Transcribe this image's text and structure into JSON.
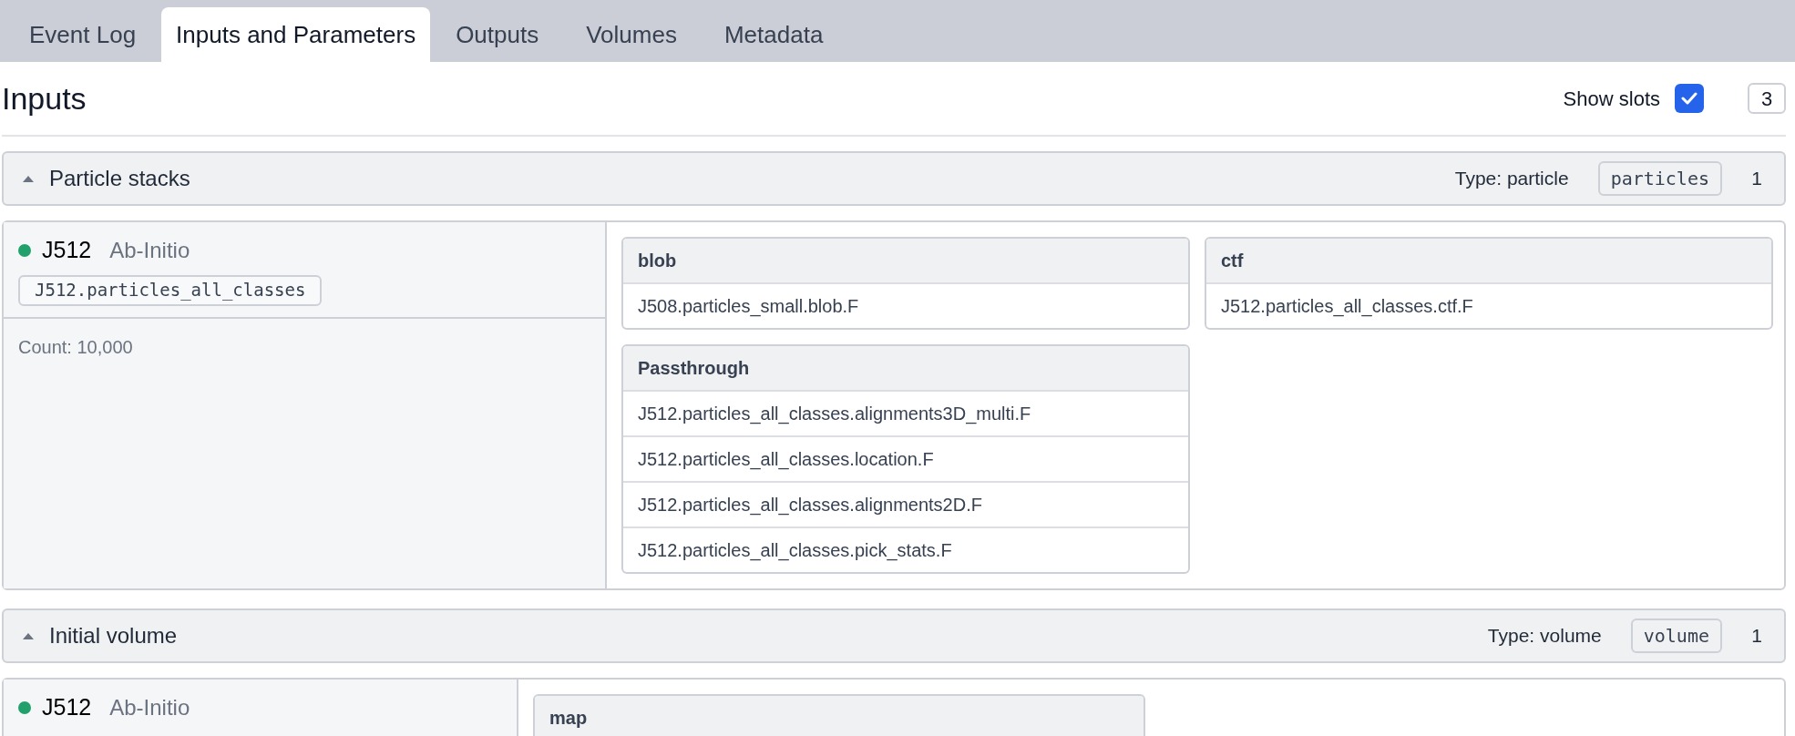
{
  "tabs": [
    {
      "label": "Event Log",
      "selected": false
    },
    {
      "label": "Inputs and Parameters",
      "selected": true
    },
    {
      "label": "Outputs",
      "selected": false
    },
    {
      "label": "Volumes",
      "selected": false
    },
    {
      "label": "Metadata",
      "selected": false
    }
  ],
  "heading": "Inputs",
  "show_slots": {
    "label": "Show slots",
    "checked": true
  },
  "input_count": "3",
  "sections": [
    {
      "title": "Particle stacks",
      "expanded": true,
      "type_label": "Type: particle",
      "type_badge": "particles",
      "count": "1",
      "sources": [
        {
          "color": "#22a06b",
          "job": "J512",
          "job_type": "Ab-Initio",
          "output": "J512.particles_all_classes",
          "count_text": "Count: 10,000"
        }
      ],
      "slot_columns": [
        [
          {
            "name": "blob",
            "values": [
              "J508.particles_small.blob.F"
            ]
          },
          {
            "name": "Passthrough",
            "values": [
              "J512.particles_all_classes.alignments3D_multi.F",
              "J512.particles_all_classes.location.F",
              "J512.particles_all_classes.alignments2D.F",
              "J512.particles_all_classes.pick_stats.F"
            ]
          }
        ],
        [
          {
            "name": "ctf",
            "values": [
              "J512.particles_all_classes.ctf.F"
            ]
          }
        ]
      ]
    },
    {
      "title": "Initial volume",
      "expanded": true,
      "type_label": "Type: volume",
      "type_badge": "volume",
      "count": "1",
      "sources": [
        {
          "color": "#22a06b",
          "job": "J512",
          "job_type": "Ab-Initio"
        }
      ],
      "slot_columns": [
        [
          {
            "name": "map"
          }
        ]
      ]
    }
  ]
}
